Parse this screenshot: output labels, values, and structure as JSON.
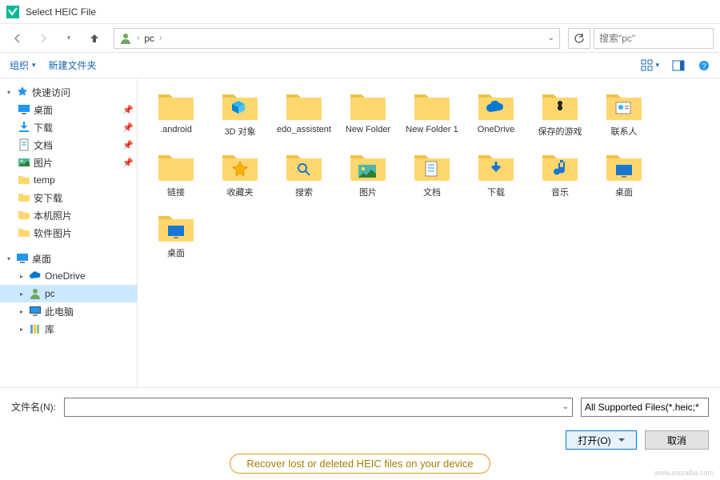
{
  "window": {
    "title": "Select HEIC File"
  },
  "nav": {
    "breadcrumb": {
      "root": "pc"
    },
    "search_placeholder": "搜索\"pc\""
  },
  "toolbar": {
    "organize": "组织",
    "new_folder": "新建文件夹"
  },
  "sidebar": {
    "quick_access": "快速访问",
    "desktop": "桌面",
    "downloads": "下载",
    "documents": "文档",
    "pictures": "图片",
    "temp": "temp",
    "anxia": "安下载",
    "local_photos": "本机照片",
    "soft_pics": "软件图片",
    "desktop2": "桌面",
    "onedrive": "OneDrive",
    "pc": "pc",
    "this_pc": "此电脑",
    "library": "库"
  },
  "items": [
    {
      "label": ".android",
      "type": "folder"
    },
    {
      "label": "3D 对象",
      "type": "folder-3d"
    },
    {
      "label": "edo_assistent",
      "type": "folder"
    },
    {
      "label": "New Folder",
      "type": "folder"
    },
    {
      "label": "New Folder 1",
      "type": "folder"
    },
    {
      "label": "OneDrive",
      "type": "folder-cloud"
    },
    {
      "label": "保存的游戏",
      "type": "folder-games"
    },
    {
      "label": "联系人",
      "type": "folder-contacts"
    },
    {
      "label": "链接",
      "type": "folder"
    },
    {
      "label": "收藏夹",
      "type": "folder-fav"
    },
    {
      "label": "搜索",
      "type": "folder-search"
    },
    {
      "label": "图片",
      "type": "folder-pics"
    },
    {
      "label": "文档",
      "type": "folder-docs"
    },
    {
      "label": "下载",
      "type": "folder-down"
    },
    {
      "label": "音乐",
      "type": "folder-music"
    },
    {
      "label": "桌面",
      "type": "folder-desk"
    },
    {
      "label": "桌面",
      "type": "folder-desk"
    }
  ],
  "file_row": {
    "label": "文件名(N):",
    "filter": "All Supported Files(*.heic;*",
    "open": "打开(O)",
    "cancel": "取消"
  },
  "footer": {
    "pill": "Recover lost or deleted HEIC files on your device"
  },
  "watermark": "www.xiazaiba.com"
}
